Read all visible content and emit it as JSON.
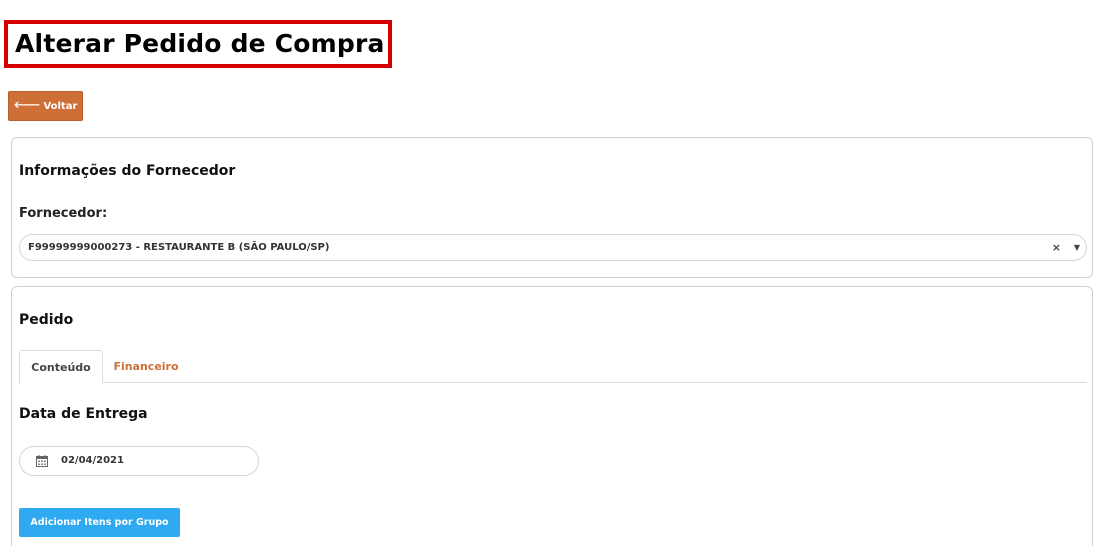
{
  "header": {
    "title": "Alterar Pedido de Compra"
  },
  "toolbar": {
    "back_label": "Voltar"
  },
  "supplier_section": {
    "title": "Informações do Fornecedor",
    "field_label": "Fornecedor:",
    "selected_value": "F99999999000273 - RESTAURANTE B (SÃO PAULO/SP)",
    "clear_symbol": "×",
    "caret_symbol": "▼"
  },
  "order_section": {
    "title": "Pedido",
    "tabs": [
      {
        "label": "Conteúdo",
        "active": true
      },
      {
        "label": "Financeiro",
        "active": false
      }
    ],
    "delivery_date_label": "Data de Entrega",
    "delivery_date_value": "02/04/2021",
    "add_items_button": "Adicionar Itens por Grupo"
  },
  "colors": {
    "title_highlight": "#d40000",
    "back_button": "#cd6f37",
    "inactive_tab": "#cd6f37",
    "add_button": "#2ea9f2"
  },
  "icons": {
    "back": "arrow-left-icon",
    "date": "calendar-icon"
  }
}
